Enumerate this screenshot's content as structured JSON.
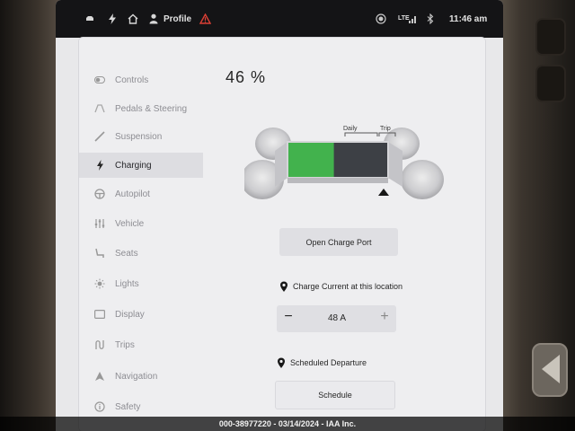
{
  "status_bar": {
    "profile_label": "Profile",
    "lte_label": "LTE",
    "clock": "11:46 am"
  },
  "battery": {
    "percent_text": "46 %",
    "charge_level": 0.46,
    "daily_label": "Daily",
    "trip_label": "Trip"
  },
  "sidebar": {
    "items": [
      {
        "label": "Controls",
        "icon": "toggle-icon",
        "active": false
      },
      {
        "label": "Pedals & Steering",
        "icon": "steering-icon",
        "active": false
      },
      {
        "label": "Suspension",
        "icon": "suspension-icon",
        "active": false
      },
      {
        "label": "Charging",
        "icon": "bolt-icon",
        "active": true
      },
      {
        "label": "Autopilot",
        "icon": "steering-wheel-icon",
        "active": false
      },
      {
        "label": "Vehicle",
        "icon": "sliders-icon",
        "active": false
      },
      {
        "label": "Seats",
        "icon": "seat-icon",
        "active": false
      },
      {
        "label": "Lights",
        "icon": "sun-icon",
        "active": false
      },
      {
        "label": "Display",
        "icon": "display-icon",
        "active": false
      },
      {
        "label": "Trips",
        "icon": "trips-icon",
        "active": false
      },
      {
        "label": "Navigation",
        "icon": "navigation-icon",
        "active": false
      },
      {
        "label": "Safety",
        "icon": "info-icon",
        "active": false
      }
    ]
  },
  "charging": {
    "open_charge_port_label": "Open Charge Port",
    "charge_current_title": "Charge Current at this location",
    "charge_current_value": "48 A",
    "scheduled_departure_title": "Scheduled Departure",
    "schedule_button_label": "Schedule"
  },
  "watermark": "000-38977220 - 03/14/2024 - IAA Inc.",
  "colors": {
    "battery_green": "#3fb54a",
    "battery_dark": "#3a3d42",
    "status_bar": "#0e0e10",
    "alert_red": "#e03c31"
  }
}
